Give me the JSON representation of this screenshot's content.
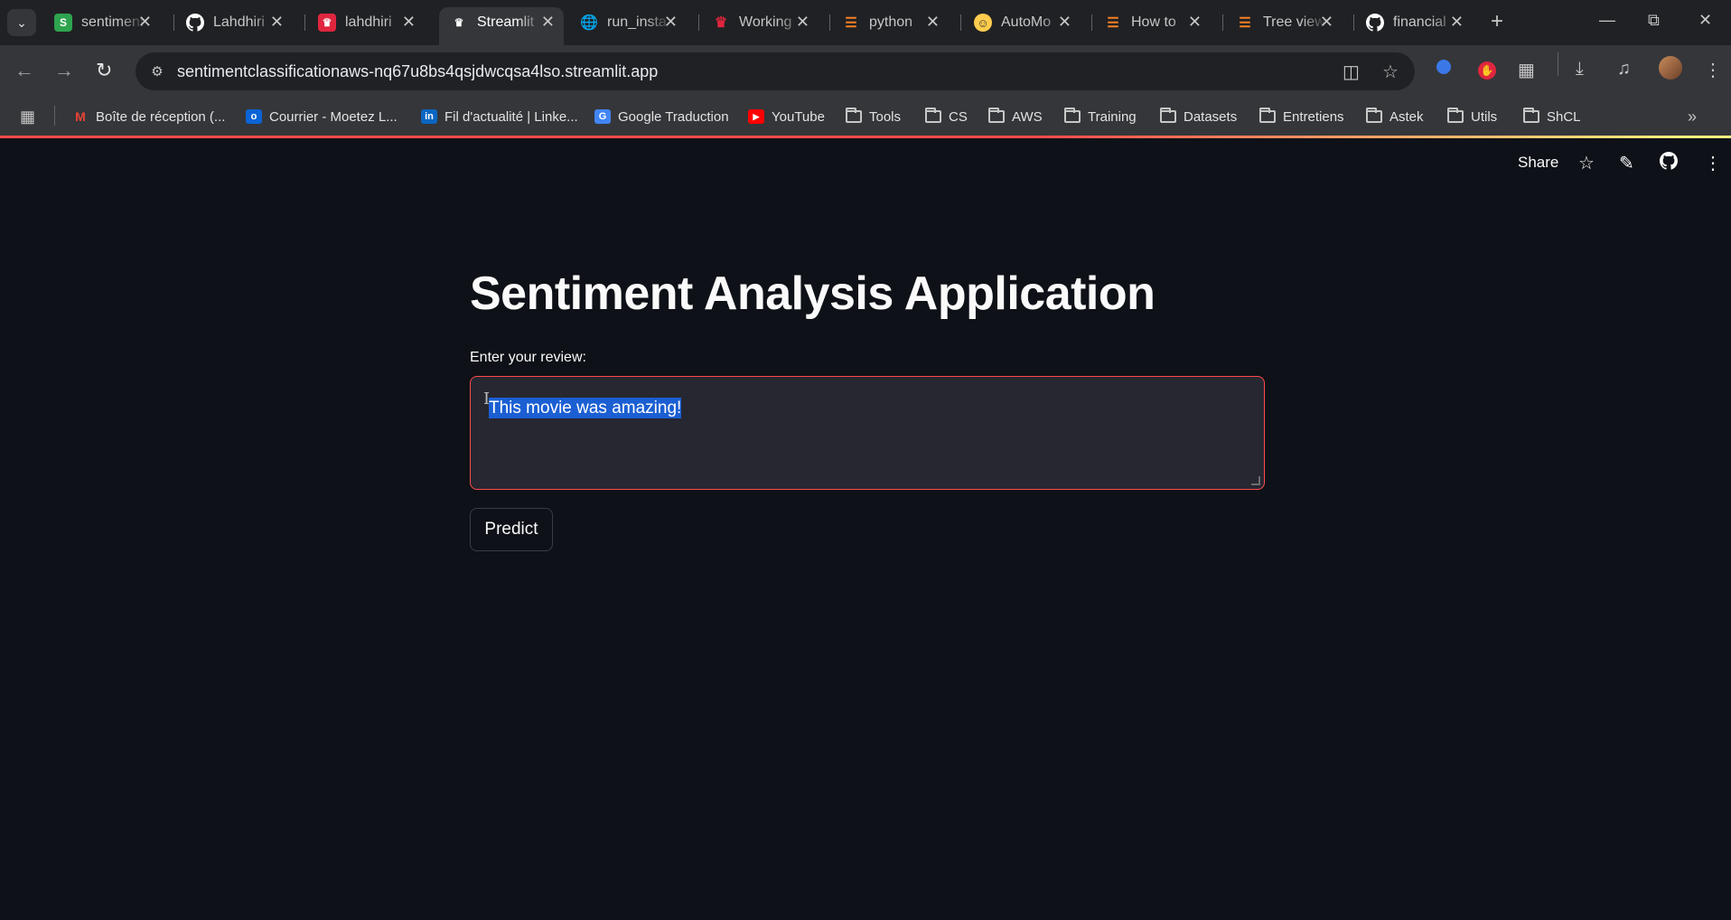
{
  "tabs": [
    {
      "title": "sentiment",
      "icon": "streamlit-green-icon",
      "color": "#2ea44f"
    },
    {
      "title": "Lahdhiri",
      "icon": "github-icon",
      "color": "#ffffff"
    },
    {
      "title": "lahdhiri",
      "icon": "crown-icon",
      "color": "#e0263e"
    },
    {
      "title": "Streamlit",
      "icon": "streamlit-crown-icon",
      "color": "#ffffff"
    },
    {
      "title": "run_insta",
      "icon": "globe-icon",
      "color": "#c7c7c7"
    },
    {
      "title": "Working",
      "icon": "crown-icon",
      "color": "#e0263e"
    },
    {
      "title": "python",
      "icon": "stackoverflow-icon",
      "color": "#f48024"
    },
    {
      "title": "AutoMo",
      "icon": "huggingface-icon",
      "color": "#ffcc4d"
    },
    {
      "title": "How to",
      "icon": "stackoverflow-icon",
      "color": "#f48024"
    },
    {
      "title": "Tree view",
      "icon": "stackoverflow-icon",
      "color": "#f48024"
    },
    {
      "title": "financial",
      "icon": "github-icon",
      "color": "#ffffff"
    }
  ],
  "active_tab_index": 3,
  "address": {
    "url": "sentimentclassificationaws-nq67u8bs4qsjdwcqsa4lso.streamlit.app"
  },
  "bookmarks": [
    {
      "label": "Boîte de réception (...",
      "icon": "gmail-icon"
    },
    {
      "label": "Courrier - Moetez L...",
      "icon": "outlook-icon"
    },
    {
      "label": "Fil d'actualité | Linke...",
      "icon": "linkedin-icon"
    },
    {
      "label": "Google Traduction",
      "icon": "translate-icon"
    },
    {
      "label": "YouTube",
      "icon": "youtube-icon"
    },
    {
      "label": "Tools",
      "icon": "folder-icon"
    },
    {
      "label": "CS",
      "icon": "folder-icon"
    },
    {
      "label": "AWS",
      "icon": "folder-icon"
    },
    {
      "label": "Training",
      "icon": "folder-icon"
    },
    {
      "label": "Datasets",
      "icon": "folder-icon"
    },
    {
      "label": "Entretiens",
      "icon": "folder-icon"
    },
    {
      "label": "Astek",
      "icon": "folder-icon"
    },
    {
      "label": "Utils",
      "icon": "folder-icon"
    },
    {
      "label": "ShCL",
      "icon": "folder-icon"
    }
  ],
  "app": {
    "share_label": "Share",
    "title": "Sentiment Analysis Application",
    "input_label": "Enter your review:",
    "input_value": "This movie was amazing!",
    "predict_label": "Predict",
    "accent_color": "#ff4b4b",
    "background_color": "#0e1117"
  }
}
